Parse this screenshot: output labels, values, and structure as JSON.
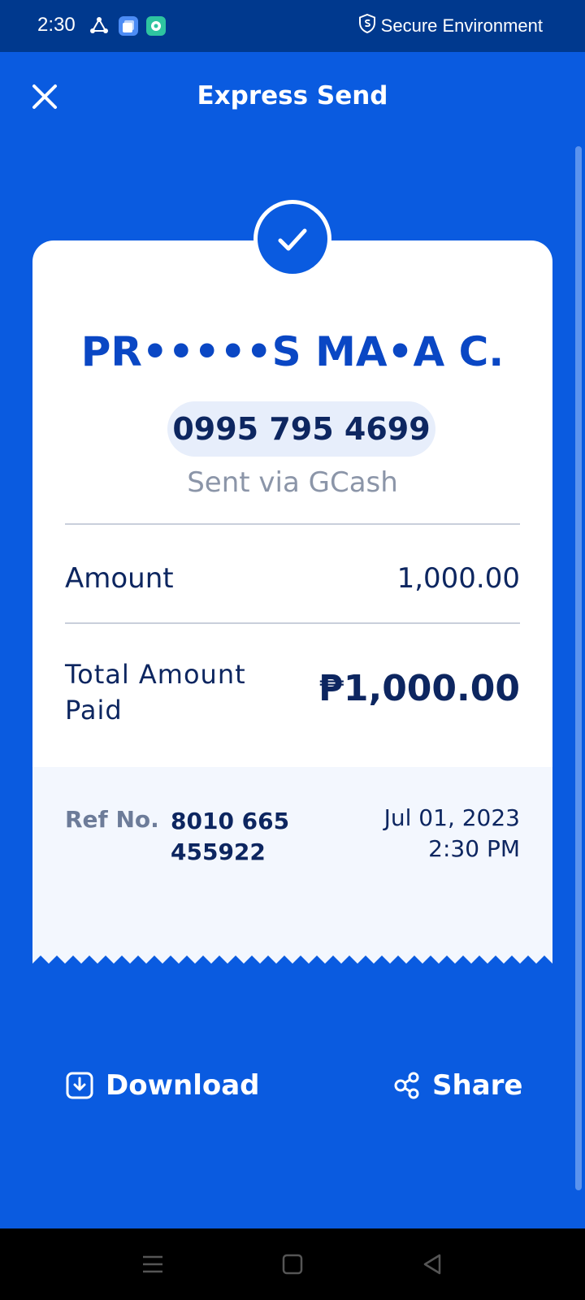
{
  "status_bar": {
    "time": "2:30",
    "secure_text": "Secure Environment",
    "app_icons": [
      "sync-app-icon",
      "stack-app-icon",
      "teal-app-icon"
    ]
  },
  "header": {
    "title": "Express Send",
    "close_icon": "close-icon"
  },
  "receipt": {
    "status_icon": "check-icon",
    "recipient_name": "PR•••••S MA•A C.",
    "phone_number": "0995 795 4699",
    "sent_via": "Sent via GCash",
    "amount_label": "Amount",
    "amount_value": "1,000.00",
    "total_label": "Total Amount Paid",
    "total_value": "₱1,000.00",
    "ref_label": "Ref No.",
    "ref_number": "8010 665 455922",
    "date": "Jul 01, 2023",
    "time": "2:30 PM"
  },
  "actions": {
    "download_label": "Download",
    "download_icon": "download-icon",
    "share_label": "Share",
    "share_icon": "share-icon"
  },
  "colors": {
    "background": "#0a5be0",
    "status_bar": "#00398e",
    "name_blue": "#0a47c4",
    "text_dark": "#0d2660",
    "text_muted": "#8b95a8"
  }
}
